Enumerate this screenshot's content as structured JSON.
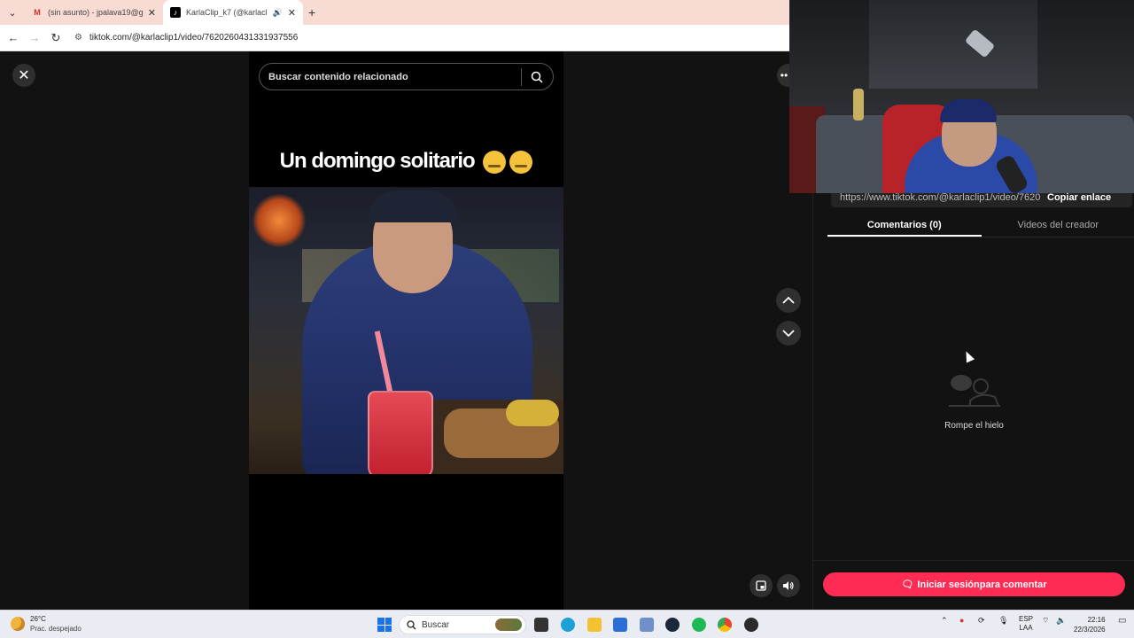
{
  "browser": {
    "tabs": [
      {
        "label": "(sin asunto) - jpalava19@gmail.com",
        "favicon": "gmail-icon",
        "active": false
      },
      {
        "label": "KarlaClip_k7 (@karlaclip1) |",
        "favicon": "tiktok-icon",
        "active": true
      }
    ],
    "url": "tiktok.com/@karlaclip1/video/7620260431331937556"
  },
  "video": {
    "search_placeholder": "Buscar contenido relacionado",
    "caption": "Un domingo solitario"
  },
  "side_panel": {
    "share_url": "https://www.tiktok.com/@karlaclip1/video/762026...",
    "copy_label": "Copiar enlace",
    "tabs": [
      {
        "label": "Comentarios (0)",
        "active": true
      },
      {
        "label": "Videos del creador",
        "active": false
      }
    ],
    "empty_text": "Rompe el hielo",
    "login_label": "Iniciar sesiónpara comentar"
  },
  "taskbar": {
    "weather_temp": "26°C",
    "weather_desc": "Prac. despejado",
    "search_label": "Buscar",
    "lang_line1": "ESP",
    "lang_line2": "LAA",
    "time": "22:16",
    "date": "22/3/2026"
  },
  "colors": {
    "accent": "#fe2c55",
    "page_bg": "#121212",
    "tabbar_bg": "#f8dcd4"
  }
}
